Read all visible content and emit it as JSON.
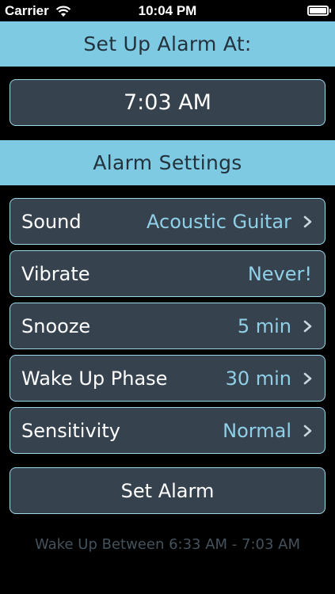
{
  "status_bar": {
    "carrier": "Carrier",
    "time": "10:04 PM"
  },
  "alarm": {
    "header": "Set Up Alarm At:",
    "time": "7:03 AM"
  },
  "settings": {
    "header": "Alarm Settings",
    "rows": [
      {
        "label": "Sound",
        "value": "Acoustic Guitar"
      },
      {
        "label": "Vibrate",
        "value": "Never!"
      },
      {
        "label": "Snooze",
        "value": "5 min"
      },
      {
        "label": "Wake Up Phase",
        "value": "30 min"
      },
      {
        "label": "Sensitivity",
        "value": "Normal"
      }
    ]
  },
  "set_alarm_button": "Set Alarm",
  "footer": "Wake Up Between 6:33 AM - 7:03 AM",
  "colors": {
    "header_bg": "#7ecae3",
    "box_bg": "#36434e",
    "box_border": "#9fd7ea",
    "value_text": "#8fd0e8"
  }
}
